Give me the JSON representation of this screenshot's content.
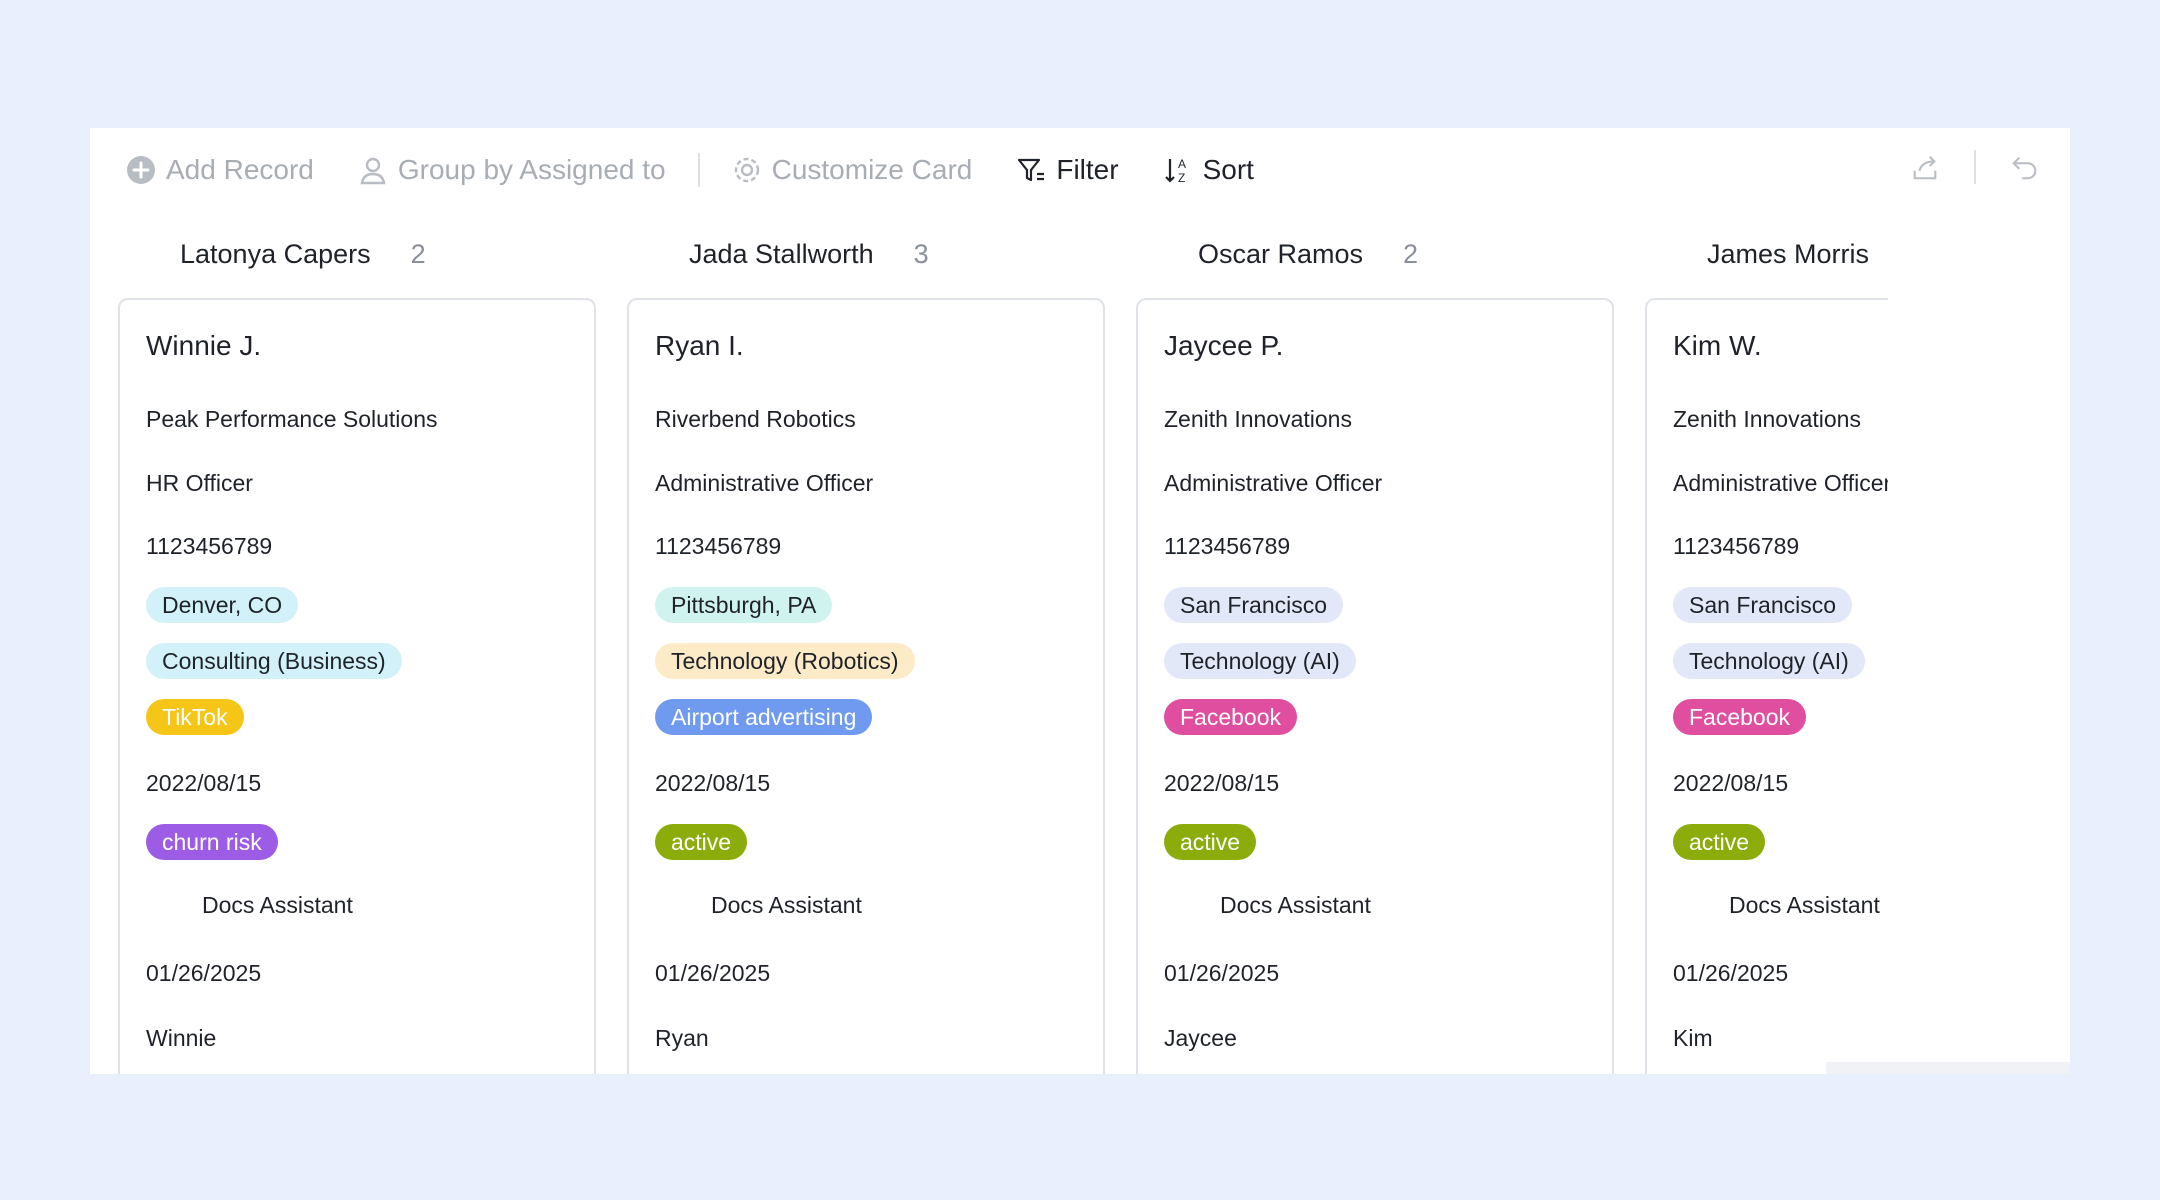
{
  "toolbar": {
    "add_record": "Add Record",
    "group_by": "Group by Assigned to",
    "customize": "Customize Card",
    "filter": "Filter",
    "sort": "Sort"
  },
  "columns": [
    {
      "name": "Latonya Capers",
      "count": "2",
      "card": {
        "title": "Winnie J.",
        "company": "Peak Performance Solutions",
        "role": "HR Officer",
        "phone": "1123456789",
        "location": "Denver, CO",
        "industry": "Consulting (Business)",
        "channel": "TikTok",
        "date": "2022/08/15",
        "status": "churn risk",
        "docs": "Docs Assistant",
        "date2": "01/26/2025",
        "first": "Winnie",
        "colors": {
          "location_bg": "#d3f1f9",
          "industry_bg": "#d3f1f9",
          "channel_bg": "#f5c518",
          "channel_fg": "#ffffff",
          "status_bg": "#9d5ce6"
        }
      }
    },
    {
      "name": "Jada Stallworth",
      "count": "3",
      "card": {
        "title": "Ryan I.",
        "company": "Riverbend Robotics",
        "role": "Administrative Officer",
        "phone": "1123456789",
        "location": "Pittsburgh, PA",
        "industry": "Technology (Robotics)",
        "channel": "Airport advertising",
        "date": "2022/08/15",
        "status": "active",
        "docs": "Docs Assistant",
        "date2": "01/26/2025",
        "first": "Ryan",
        "colors": {
          "location_bg": "#d1f3ef",
          "industry_bg": "#fdebc8",
          "channel_bg": "#6f9af0",
          "channel_fg": "#ffffff",
          "status_bg": "#8cac0c"
        }
      }
    },
    {
      "name": "Oscar Ramos",
      "count": "2",
      "card": {
        "title": "Jaycee P.",
        "company": "Zenith Innovations",
        "role": "Administrative Officer",
        "phone": "1123456789",
        "location": "San Francisco",
        "industry": "Technology (AI)",
        "channel": "Facebook",
        "date": "2022/08/15",
        "status": "active",
        "docs": "Docs Assistant",
        "date2": "01/26/2025",
        "first": "Jaycee",
        "colors": {
          "location_bg": "#e3e8f8",
          "industry_bg": "#e3e8f8",
          "channel_bg": "#e04f9f",
          "channel_fg": "#ffffff",
          "status_bg": "#8cac0c"
        }
      }
    },
    {
      "name": "James Morris",
      "count": "",
      "card": {
        "title": "Kim W.",
        "company": "Zenith Innovations",
        "role": "Administrative Officer",
        "phone": "1123456789",
        "location": "San Francisco",
        "industry": "Technology (AI)",
        "channel": "Facebook",
        "date": "2022/08/15",
        "status": "active",
        "docs": "Docs Assistant",
        "date2": "01/26/2025",
        "first": "Kim",
        "colors": {
          "location_bg": "#e3e8f8",
          "industry_bg": "#e3e8f8",
          "channel_bg": "#e04f9f",
          "channel_fg": "#ffffff",
          "status_bg": "#8cac0c"
        }
      }
    }
  ]
}
